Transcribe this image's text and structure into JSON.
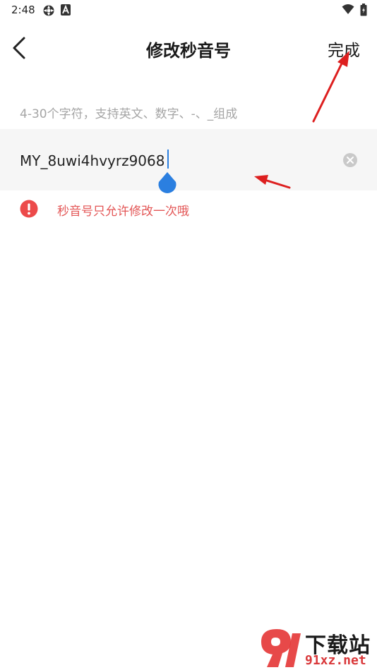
{
  "status_bar": {
    "time": "2:48",
    "icons": [
      "gear-icon",
      "a-icon",
      "wifi-icon",
      "battery-icon"
    ]
  },
  "header": {
    "title": "修改秒音号",
    "done_label": "完成",
    "back_icon": "chevron-left-icon"
  },
  "form": {
    "hint": "4-30个字符，支持英文、数字、-、_组成",
    "value": "MY_8uwi4hvyrz9068",
    "clear_icon": "clear-icon"
  },
  "warning": {
    "icon": "exclamation-circle-icon",
    "text": "秒音号只允许修改一次哦"
  },
  "watermark": {
    "title": "下载站",
    "url": "91xz.net"
  },
  "colors": {
    "accent": "#2b7fe0",
    "warning": "#e35656",
    "annotation_arrow": "#dd1f1f",
    "input_background": "#f6f6f6"
  }
}
